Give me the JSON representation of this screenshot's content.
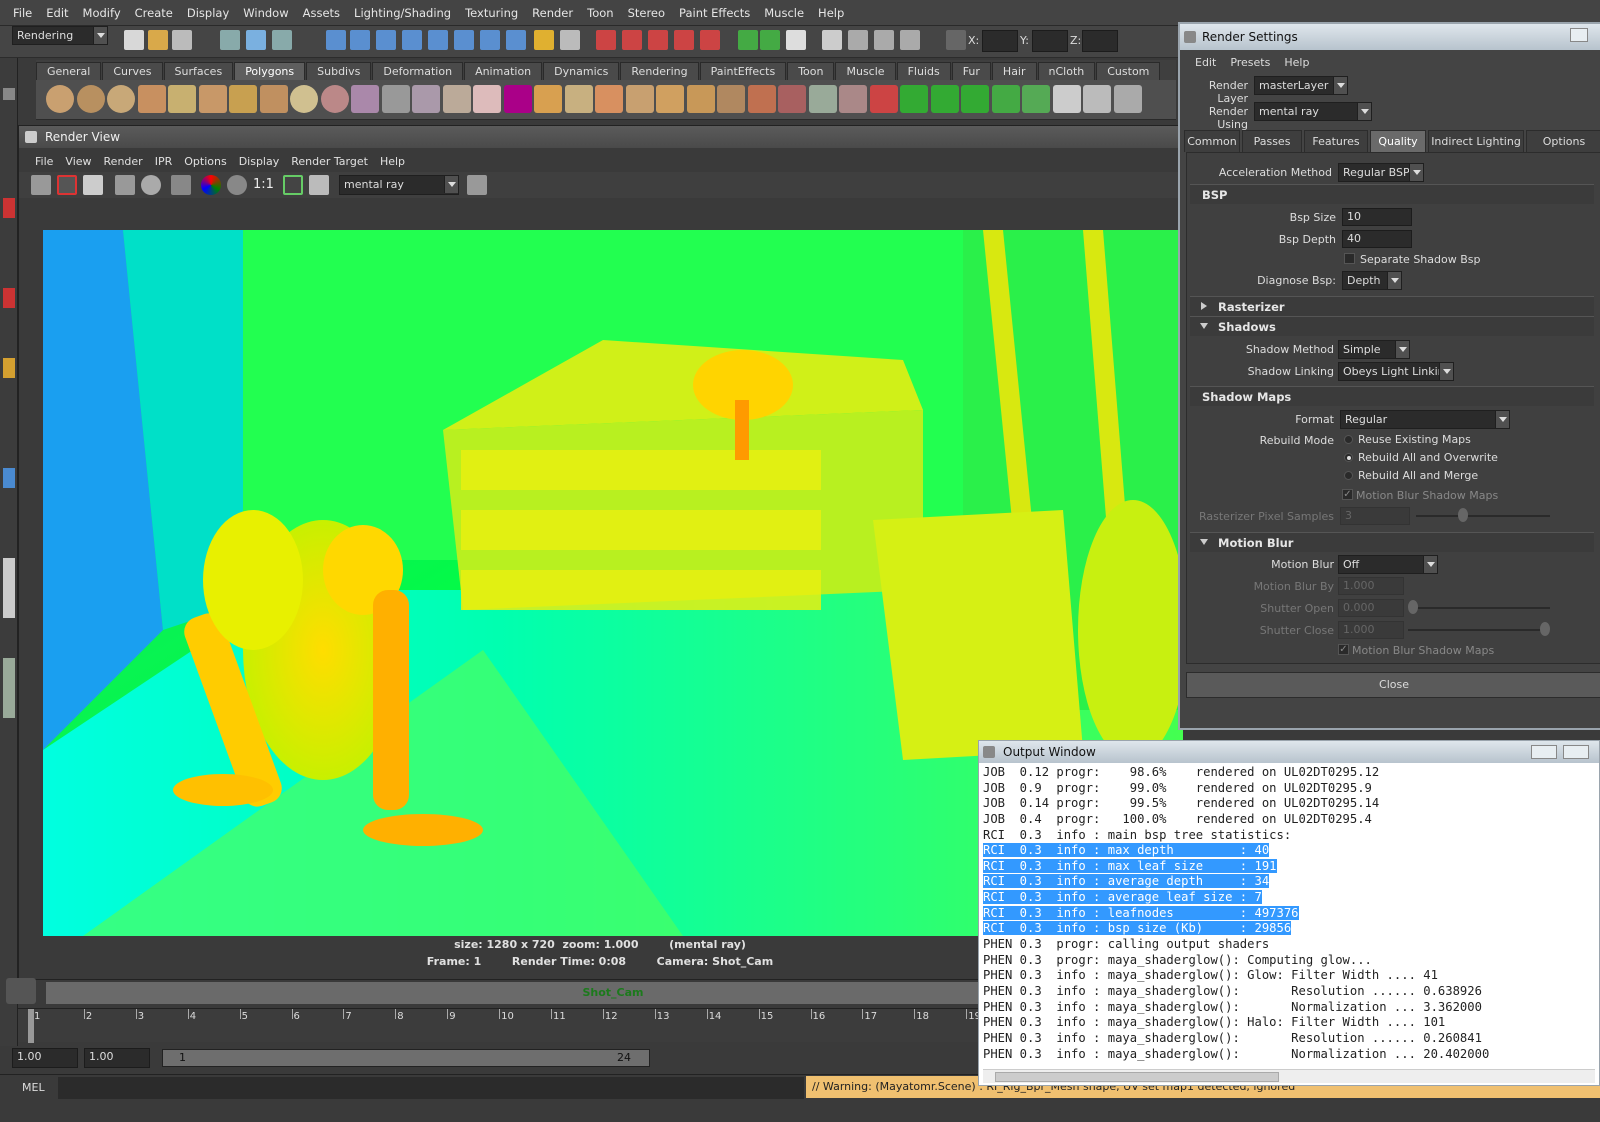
{
  "menubar": [
    "File",
    "Edit",
    "Modify",
    "Create",
    "Display",
    "Window",
    "Assets",
    "Lighting/Shading",
    "Texturing",
    "Render",
    "Toon",
    "Stereo",
    "Paint Effects",
    "Muscle",
    "Help"
  ],
  "statusline": {
    "menu_set": "Rendering",
    "x_label": "X:",
    "y_label": "Y:",
    "z_label": "Z:"
  },
  "shelf_tabs": [
    "General",
    "Curves",
    "Surfaces",
    "Polygons",
    "Subdivs",
    "Deformation",
    "Animation",
    "Dynamics",
    "Rendering",
    "PaintEffects",
    "Toon",
    "Muscle",
    "Fluids",
    "Fur",
    "Hair",
    "nCloth",
    "Custom"
  ],
  "shelf_active": "Polygons",
  "render_view": {
    "title": "Render View",
    "menu": [
      "File",
      "View",
      "Render",
      "IPR",
      "Options",
      "Display",
      "Render Target",
      "Help"
    ],
    "zoom_label": "1:1",
    "renderer": "mental ray",
    "info_line1": "size: 1280 x 720  zoom: 1.000        (mental ray)",
    "info_line2": "Frame: 1        Render Time: 0:08        Camera: Shot_Cam"
  },
  "camera_bar": "Shot_Cam",
  "timeline": {
    "ticks": [
      "1",
      "2",
      "3",
      "4",
      "5",
      "6",
      "7",
      "8",
      "9",
      "10",
      "11",
      "12",
      "13",
      "14",
      "15",
      "16",
      "17",
      "18",
      "19"
    ]
  },
  "range": {
    "start": "1.00",
    "start2": "1.00",
    "range_start": "1",
    "range_end": "24"
  },
  "command": {
    "label": "MEL",
    "warning": "// Warning: (Mayatomr.Scene) : RI_Rig_Bpr_Mesh shape, UV set map1 detected, ignored"
  },
  "render_settings": {
    "title": "Render Settings",
    "menu": [
      "Edit",
      "Presets",
      "Help"
    ],
    "render_layer_label": "Render Layer",
    "render_layer": "masterLayer",
    "render_using_label": "Render Using",
    "render_using": "mental ray",
    "tabs": [
      "Common",
      "Passes",
      "Features",
      "Quality",
      "Indirect Lighting",
      "Options"
    ],
    "active_tab": "Quality",
    "accel_label": "Acceleration Method",
    "accel": "Regular BSP",
    "bsp_header": "BSP",
    "bsp_size_label": "Bsp Size",
    "bsp_size": "10",
    "bsp_depth_label": "Bsp Depth",
    "bsp_depth": "40",
    "separate_shadow": "Separate Shadow Bsp",
    "diagnose_label": "Diagnose Bsp:",
    "diagnose": "Depth",
    "rasterizer": "Rasterizer",
    "shadows": "Shadows",
    "shadow_method_label": "Shadow Method",
    "shadow_method": "Simple",
    "shadow_linking_label": "Shadow Linking",
    "shadow_linking": "Obeys Light Linking",
    "shadow_maps": "Shadow Maps",
    "format_label": "Format",
    "format": "Regular",
    "rebuild_label": "Rebuild Mode",
    "rebuild_options": [
      "Reuse Existing Maps",
      "Rebuild All and Overwrite",
      "Rebuild All and Merge"
    ],
    "rebuild_selected": 1,
    "mb_shadow_maps": "Motion Blur Shadow Maps",
    "raster_samples_label": "Rasterizer Pixel Samples",
    "raster_samples": "3",
    "motion_blur_header": "Motion Blur",
    "motion_blur_label": "Motion Blur",
    "motion_blur": "Off",
    "mb_by_label": "Motion Blur By",
    "mb_by": "1.000",
    "shutter_open_label": "Shutter Open",
    "shutter_open": "0.000",
    "shutter_close_label": "Shutter Close",
    "shutter_close": "1.000",
    "mb_shadow_maps2": "Motion Blur Shadow Maps",
    "close": "Close"
  },
  "output_window": {
    "title": "Output Window",
    "lines": [
      {
        "t": "JOB  0.12 progr:    98.6%    rendered on UL02DT0295.12",
        "h": false
      },
      {
        "t": "JOB  0.9  progr:    99.0%    rendered on UL02DT0295.9",
        "h": false
      },
      {
        "t": "JOB  0.14 progr:    99.5%    rendered on UL02DT0295.14",
        "h": false
      },
      {
        "t": "JOB  0.4  progr:   100.0%    rendered on UL02DT0295.4",
        "h": false
      },
      {
        "t": "RCI  0.3  info : main bsp tree statistics:",
        "h": false
      },
      {
        "t": "RCI  0.3  info : max depth         : 40",
        "h": true
      },
      {
        "t": "RCI  0.3  info : max leaf size     : 191",
        "h": true
      },
      {
        "t": "RCI  0.3  info : average depth     : 34",
        "h": true
      },
      {
        "t": "RCI  0.3  info : average leaf size : 7",
        "h": true
      },
      {
        "t": "RCI  0.3  info : leafnodes         : 497376",
        "h": true
      },
      {
        "t": "RCI  0.3  info : bsp size (Kb)     : 29856",
        "h": true
      },
      {
        "t": "PHEN 0.3  progr: calling output shaders",
        "h": false
      },
      {
        "t": "PHEN 0.3  progr: maya_shaderglow(): Computing glow...",
        "h": false
      },
      {
        "t": "PHEN 0.3  info : maya_shaderglow(): Glow: Filter Width .... 41",
        "h": false
      },
      {
        "t": "PHEN 0.3  info : maya_shaderglow():       Resolution ...... 0.638926",
        "h": false
      },
      {
        "t": "PHEN 0.3  info : maya_shaderglow():       Normalization ... 3.362000",
        "h": false
      },
      {
        "t": "PHEN 0.3  info : maya_shaderglow(): Halo: Filter Width .... 101",
        "h": false
      },
      {
        "t": "PHEN 0.3  info : maya_shaderglow():       Resolution ...... 0.260841",
        "h": false
      },
      {
        "t": "PHEN 0.3  info : maya_shaderglow():       Normalization ... 20.402000",
        "h": false
      }
    ]
  }
}
